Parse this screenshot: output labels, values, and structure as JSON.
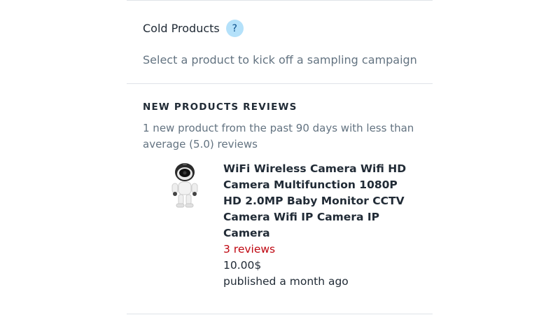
{
  "cold_products": {
    "title": "Cold Products",
    "help_label": "?",
    "description": "Select a product to kick off a sampling campaign"
  },
  "new_products": {
    "heading": "NEW PRODUCTS REVIEWS",
    "description": "1 new product from the past 90 days with less than average (5.0) reviews",
    "product": {
      "image_icon": "robot-camera-icon",
      "title": "WiFi Wireless Camera Wifi HD Camera Multifunction 1080P HD 2.0MP Baby Monitor CCTV Camera Wifi IP Camera IP Camera",
      "reviews": "3 reviews",
      "price": "10.00$",
      "published": "published a month ago"
    }
  },
  "colors": {
    "reviews_accent": "#bf0711",
    "help_badge": "#b4e1fa",
    "muted_text": "#637381"
  }
}
